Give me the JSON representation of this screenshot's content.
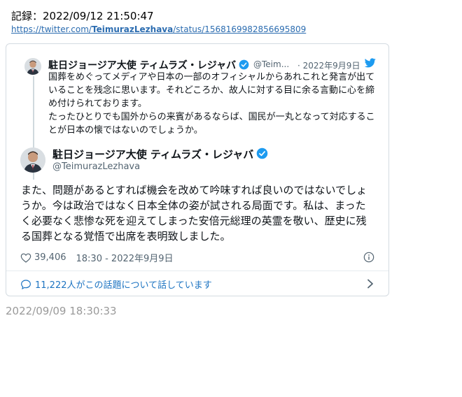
{
  "record": {
    "label": "記録：2022/09/12 21:50:47"
  },
  "source_url": {
    "prefix": "https://twitter.com/",
    "user": "TeimurazLezhava",
    "suffix": "/status/1568169982856695809"
  },
  "quoted_tweet": {
    "author_name": "駐日ジョージア大使 ティムラズ・レジャバ",
    "handle": "@Teim...",
    "date": "· 2022年9月9日",
    "paragraphs": [
      "国葬をめぐってメディアや日本の一部のオフィシャルからあれこれと発言が出ていることを残念に思います。それどころか、故人に対する目に余る言動に心を締め付けられております。",
      "たったひとりでも国外からの来賓があるならば、国民が一丸となって対応することが日本の懐ではないのでしょうか。"
    ]
  },
  "main_tweet": {
    "author_name": "駐日ジョージア大使 ティムラズ・レジャバ",
    "handle": "@TeimurazLezhava",
    "body": "また、問題があるとすれば機会を改めて吟味すれば良いのではないでしょうか。今は政治ではなく日本全体の姿が試される局面です。私は、まったく必要なく悲惨な死を迎えてしまった安倍元総理の英霊を敬い、歴史に残る国葬となる覚悟で出席を表明致しました。",
    "likes": "39,406",
    "timestamp": "18:30 - 2022年9月9日",
    "conversation": "11,222人がこの話題について話しています"
  },
  "footer_timestamp": "2022/09/09 18:30:33",
  "colors": {
    "accent": "#1d9bf0",
    "link": "#1d74c2",
    "muted": "#536471"
  },
  "icons": [
    "verified-badge-icon",
    "twitter-bird-icon",
    "heart-icon",
    "info-icon",
    "speech-bubble-icon",
    "chevron-right-icon"
  ]
}
